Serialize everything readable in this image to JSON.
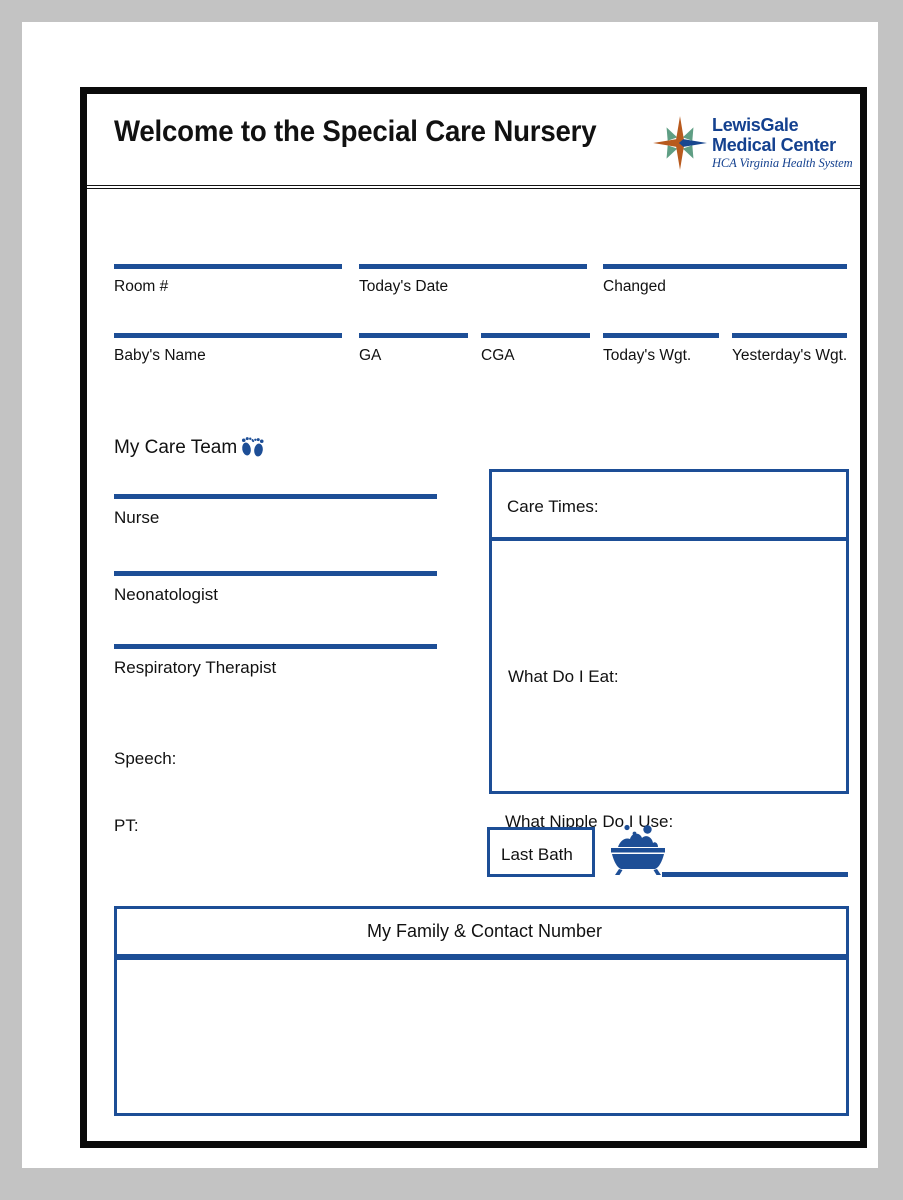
{
  "header": {
    "title": "Welcome to the Special Care Nursery",
    "logo": {
      "line1": "LewisGale",
      "line2": "Medical Center",
      "tagline": "HCA Virginia Health System",
      "star_colors": {
        "orange": "#b85a1e",
        "blue": "#18468f",
        "green": "#5f9e84"
      }
    }
  },
  "fields_row1": [
    {
      "label": "Room #"
    },
    {
      "label": "Today's Date"
    },
    {
      "label": "Changed"
    }
  ],
  "fields_row2": [
    {
      "label": "Baby's Name"
    },
    {
      "label": "GA"
    },
    {
      "label": "CGA"
    },
    {
      "label": "Today's Wgt."
    },
    {
      "label": "Yesterday's Wgt."
    }
  ],
  "care_team": {
    "heading": "My Care Team",
    "icon": "baby-footprints-icon",
    "members": [
      {
        "label": "Nurse"
      },
      {
        "label": "Neonatologist"
      },
      {
        "label": "Respiratory Therapist"
      }
    ],
    "extra": [
      {
        "label": "Speech:"
      },
      {
        "label": "PT:"
      }
    ]
  },
  "care_panel": {
    "care_times_label": "Care Times:",
    "eat_label": "What Do I Eat:",
    "nipple_label": "What Nipple Do I Use:"
  },
  "bath": {
    "label": "Last Bath",
    "icon": "bathtub-icon"
  },
  "family": {
    "heading": "My Family & Contact Number"
  },
  "colors": {
    "accent_blue": "#1d4e96",
    "logo_blue": "#14418f",
    "frame_black": "#0a0a0a",
    "page_background": "#c3c3c3"
  }
}
